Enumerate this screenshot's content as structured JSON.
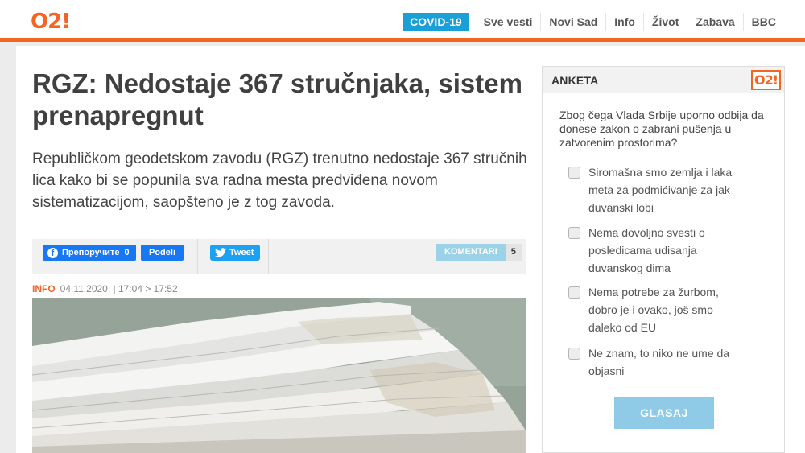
{
  "header": {
    "logo": "O2!",
    "nav": [
      {
        "label": "COVID-19"
      },
      {
        "label": "Sve vesti"
      },
      {
        "label": "Novi Sad"
      },
      {
        "label": "Info"
      },
      {
        "label": "Život"
      },
      {
        "label": "Zabava"
      },
      {
        "label": "BBC"
      }
    ]
  },
  "article": {
    "title": "RGZ: Nedostaje 367 stručnjaka, sistem prenapregnut",
    "lead": "Republičkom geodetskom zavodu (RGZ) trenutno nedostaje 367 stručnih lica kako bi se popunila sva radna mesta predviđena novom sistematizacijom, saopšteno je z tog zavoda.",
    "share": {
      "fb_like_label": "Препоручите",
      "fb_like_count": "0",
      "fb_share_label": "Podeli",
      "tweet_label": "Tweet",
      "comments_label": "KOMENTARI",
      "comments_count": "5"
    },
    "meta": {
      "category": "INFO",
      "datetime": "04.11.2020. | 17:04 > 17:52"
    }
  },
  "poll": {
    "title": "ANKETA",
    "logo": "O2!",
    "question": "Zbog čega Vlada Srbije uporno odbija da donese zakon o zabrani pušenja u zatvorenim prostorima?",
    "options": [
      {
        "label": "Siromašna smo zemlja i laka meta za podmićivanje za jak duvanski lobi"
      },
      {
        "label": "Nema dovoljno svesti o posledicama udisanja duvanskog dima"
      },
      {
        "label": "Nema potrebe za žurbom, dobro je i ovako, još smo daleko od EU"
      },
      {
        "label": "Ne znam, to niko ne ume da objasni"
      }
    ],
    "vote_label": "GLASAJ"
  },
  "colors": {
    "brand": "#f26522",
    "covid": "#1a9fd6",
    "facebook": "#1877f2",
    "twitter": "#1da1f2",
    "vote": "#8fcbe6"
  }
}
